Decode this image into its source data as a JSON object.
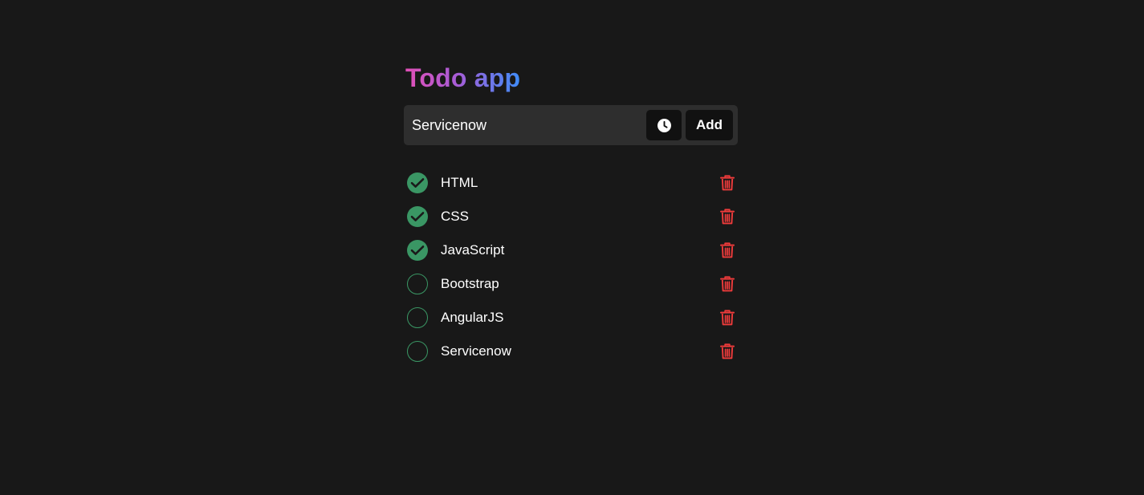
{
  "app": {
    "title": "Todo app"
  },
  "input": {
    "value": "Servicenow",
    "add_label": "Add",
    "clock_icon": "clock-icon"
  },
  "colors": {
    "background": "#181818",
    "input_bg": "#2e2e2e",
    "button_bg": "#111111",
    "check_green": "#3a9664",
    "delete_red": "#ef3b3b",
    "title_gradient": [
      "#e34fb6",
      "#3f8cf7"
    ]
  },
  "todos": [
    {
      "text": "HTML",
      "done": true
    },
    {
      "text": "CSS",
      "done": true
    },
    {
      "text": "JavaScript",
      "done": true
    },
    {
      "text": "Bootstrap",
      "done": false
    },
    {
      "text": "AngularJS",
      "done": false
    },
    {
      "text": "Servicenow",
      "done": false
    }
  ]
}
